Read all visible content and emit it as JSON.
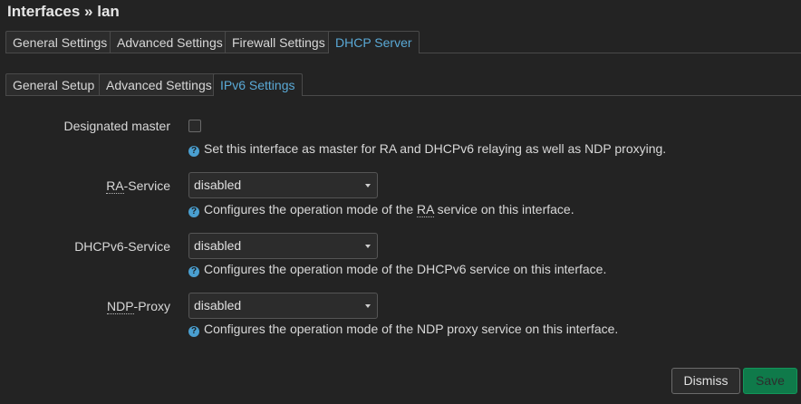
{
  "page": {
    "title": "Interfaces » lan"
  },
  "main_tabs": [
    {
      "label": "General Settings"
    },
    {
      "label": "Advanced Settings"
    },
    {
      "label": "Firewall Settings"
    },
    {
      "label": "DHCP Server"
    }
  ],
  "sub_tabs": [
    {
      "label": "General Setup"
    },
    {
      "label": "Advanced Settings"
    },
    {
      "label": "IPv6 Settings"
    }
  ],
  "active_main_tab": "DHCP Server",
  "active_sub_tab": "IPv6 Settings",
  "fields": {
    "designated_master": {
      "label": "Designated master",
      "checked": false,
      "help": "Set this interface as master for RA and DHCPv6 relaying as well as NDP proxying."
    },
    "ra_service": {
      "label_abbr": "RA",
      "label_rest": "-Service",
      "value": "disabled",
      "help_pre": "Configures the operation mode of the ",
      "help_abbr": "RA",
      "help_post": " service on this interface."
    },
    "dhcpv6_service": {
      "label": "DHCPv6-Service",
      "value": "disabled",
      "help": "Configures the operation mode of the DHCPv6 service on this interface."
    },
    "ndp_proxy": {
      "label_abbr": "NDP",
      "label_rest": "-Proxy",
      "value": "disabled",
      "help": "Configures the operation mode of the NDP proxy service on this interface."
    }
  },
  "buttons": {
    "dismiss": "Dismiss",
    "save": "Save"
  },
  "icons": {
    "help": "question-circle-icon",
    "dropdown": "caret-down-icon"
  },
  "colors": {
    "accent": "#5aa9d6",
    "save": "#0f7a4a",
    "background": "#232323"
  }
}
